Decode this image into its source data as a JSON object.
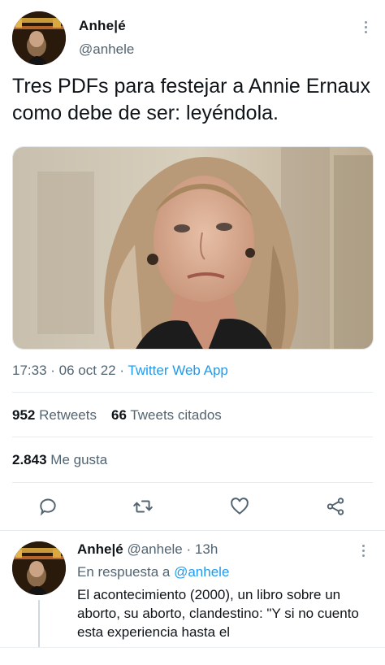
{
  "tweet": {
    "author_name": "Anhe|é",
    "author_handle": "@anhele",
    "text": "Tres PDFs para festejar a Annie Ernaux como debe de ser: leyéndola.",
    "time": "17:33",
    "date": "06 oct 22",
    "separator": " · ",
    "source": "Twitter Web App",
    "stats": {
      "retweets_count": "952",
      "retweets_label": "Retweets",
      "quotes_count": "66",
      "quotes_label": "Tweets citados",
      "likes_count": "2.843",
      "likes_label": "Me gusta"
    },
    "image_description_icon": "photo"
  },
  "actions": [
    {
      "icon": "reply-icon"
    },
    {
      "icon": "retweet-icon"
    },
    {
      "icon": "like-icon"
    },
    {
      "icon": "share-icon"
    }
  ],
  "reply": {
    "author_name": "Anhe|é",
    "author_handle": "@anhele",
    "dot": "·",
    "time_ago": "13h",
    "in_reply_prefix": "En respuesta a",
    "in_reply_handle": "@anhele",
    "text": "El acontecimiento (2000), un libro sobre un aborto, su aborto, clandestino: \"Y si no cuento esta experiencia hasta el"
  },
  "colors": {
    "accent": "#1d9bf0",
    "secondary_text": "#536471",
    "primary_text": "#0f1419",
    "divider": "#e6ebee"
  }
}
